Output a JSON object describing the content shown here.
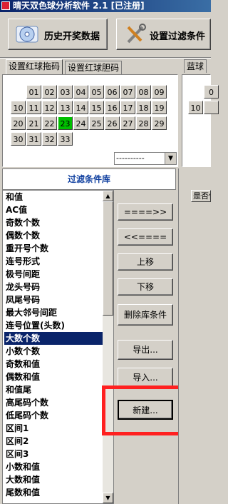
{
  "window": {
    "title": "晴天双色球分析软件 2.1  [已注册]"
  },
  "toolbar": {
    "history_label": "历史开奖数据",
    "filter_label": "设置过滤条件"
  },
  "tabs": {
    "red_drag": "设置红球拖码",
    "red_gall": "设置红球胆码",
    "blue": "蓝球"
  },
  "red_numbers": [
    "01",
    "02",
    "03",
    "04",
    "05",
    "06",
    "07",
    "08",
    "09",
    "10",
    "11",
    "12",
    "13",
    "14",
    "15",
    "16",
    "17",
    "18",
    "19",
    "20",
    "21",
    "22",
    "23",
    "24",
    "25",
    "26",
    "27",
    "28",
    "29",
    "30",
    "31",
    "32",
    "33"
  ],
  "selected_number": "23",
  "blue_numbers_visible": [
    "0",
    "10"
  ],
  "dropdown": {
    "value": "----------"
  },
  "library": {
    "header": "过滤条件库",
    "items": [
      "和值",
      "AC值",
      "奇数个数",
      "偶数个数",
      "重开号个数",
      "连号形式",
      "极号间距",
      "龙头号码",
      "凤尾号码",
      "最大邻号间距",
      "连号位置(头数)",
      "大数个数",
      "小数个数",
      "奇数和值",
      "偶数和值",
      "和值尾",
      "高尾码个数",
      "低尾码个数",
      "区间1",
      "区间2",
      "区间3",
      "小数和值",
      "大数和值",
      "尾数和值"
    ],
    "selected_index": 11
  },
  "actions": {
    "add": "====>>",
    "remove": "<<====",
    "move_up": "上移",
    "move_down": "下移",
    "delete": "删除库条件",
    "export": "导出...",
    "import": "导入...",
    "new": "新建..."
  },
  "grid": {
    "col_header": "是否使用"
  },
  "colors": {
    "selected_cell": "#00c000",
    "highlight_box": "#ff2020",
    "list_selection": "#0a246a"
  }
}
